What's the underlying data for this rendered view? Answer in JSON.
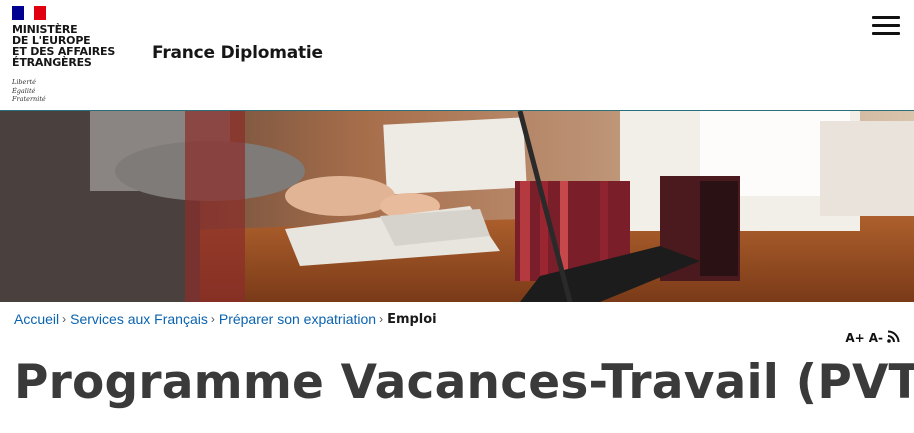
{
  "header": {
    "ministry_lines": [
      "MINISTÈRE",
      "DE L'EUROPE",
      "ET DES AFFAIRES",
      "ÉTRANGÈRES"
    ],
    "motto": [
      "Liberté",
      "Égalité",
      "Fraternité"
    ],
    "site_title": "France Diplomatie",
    "menu_icon": "hamburger-menu-icon"
  },
  "breadcrumb": {
    "items": [
      "Accueil",
      "Services aux Français",
      "Préparer son expatriation"
    ],
    "current": "Emploi"
  },
  "tools": {
    "font_increase": "A+",
    "font_decrease": "A-",
    "rss_icon": "rss-icon"
  },
  "page": {
    "title": "Programme Vacances-Travail (PVT)"
  },
  "colors": {
    "flag_blue": "#000091",
    "flag_red": "#e1000f",
    "link_blue": "#0a63b0",
    "header_border": "#2a6f7a",
    "title_gray": "#3a3a3a"
  }
}
